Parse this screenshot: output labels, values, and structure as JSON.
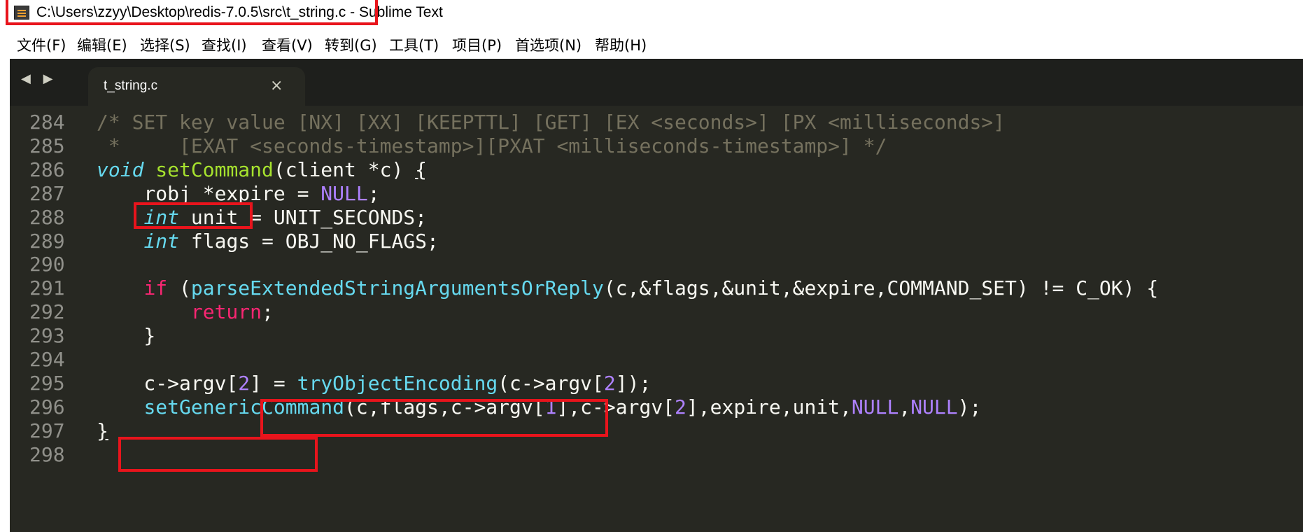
{
  "window": {
    "title": "C:\\Users\\zzyy\\Desktop\\redis-7.0.5\\src\\t_string.c - Sublime Text"
  },
  "menu": [
    "文件(F)",
    "编辑(E)",
    "选择(S)",
    "查找(I)",
    "查看(V)",
    "转到(G)",
    "工具(T)",
    "项目(P)",
    "首选项(N)",
    "帮助(H)"
  ],
  "tabs": {
    "active": {
      "label": "t_string.c",
      "close": "×"
    },
    "nav": "◀ ▶"
  },
  "code_lines": [
    {
      "num": "284",
      "tokens": [
        [
          "c-comment",
          "/* SET key value [NX] [XX] [KEEPTTL] [GET] [EX <seconds>] [PX <milliseconds>]"
        ]
      ]
    },
    {
      "num": "285",
      "tokens": [
        [
          "c-comment",
          " *     [EXAT <seconds-timestamp>][PXAT <milliseconds-timestamp>] */"
        ]
      ]
    },
    {
      "num": "286",
      "tokens": [
        [
          "c-type",
          "void"
        ],
        [
          "",
          " "
        ],
        [
          "c-func",
          "setCommand"
        ],
        [
          "",
          "(client *c) "
        ],
        [
          "c-brace",
          "{"
        ]
      ]
    },
    {
      "num": "287",
      "tokens": [
        [
          "",
          "    robj *expire = "
        ],
        [
          "c-const",
          "NULL"
        ],
        [
          "",
          ";"
        ]
      ]
    },
    {
      "num": "288",
      "tokens": [
        [
          "",
          "    "
        ],
        [
          "c-type",
          "int"
        ],
        [
          "",
          " unit = UNIT_SECONDS;"
        ]
      ]
    },
    {
      "num": "289",
      "tokens": [
        [
          "",
          "    "
        ],
        [
          "c-type",
          "int"
        ],
        [
          "",
          " flags = OBJ_NO_FLAGS;"
        ]
      ]
    },
    {
      "num": "290",
      "tokens": []
    },
    {
      "num": "291",
      "tokens": [
        [
          "",
          "    "
        ],
        [
          "c-kw",
          "if"
        ],
        [
          "",
          " ("
        ],
        [
          "c-call",
          "parseExtendedStringArgumentsOrReply"
        ],
        [
          "",
          "(c,&flags,&unit,&expire,COMMAND_SET) != C_OK) {"
        ]
      ]
    },
    {
      "num": "292",
      "tokens": [
        [
          "",
          "        "
        ],
        [
          "c-kw",
          "return"
        ],
        [
          "",
          ";"
        ]
      ]
    },
    {
      "num": "293",
      "tokens": [
        [
          "",
          "    }"
        ]
      ]
    },
    {
      "num": "294",
      "tokens": []
    },
    {
      "num": "295",
      "tokens": [
        [
          "",
          "    c->argv["
        ],
        [
          "c-num",
          "2"
        ],
        [
          "",
          "] = "
        ],
        [
          "c-call",
          "tryObjectEncoding"
        ],
        [
          "",
          "(c->argv["
        ],
        [
          "c-num",
          "2"
        ],
        [
          "",
          "]);"
        ]
      ]
    },
    {
      "num": "296",
      "tokens": [
        [
          "",
          "    "
        ],
        [
          "c-call",
          "setGenericCommand"
        ],
        [
          "",
          "(c,flags,c->argv["
        ],
        [
          "c-num",
          "1"
        ],
        [
          "",
          "],c->argv["
        ],
        [
          "c-num",
          "2"
        ],
        [
          "",
          "],expire,unit,"
        ],
        [
          "c-const",
          "NULL"
        ],
        [
          "",
          ","
        ],
        [
          "c-const",
          "NULL"
        ],
        [
          "",
          ");"
        ]
      ]
    },
    {
      "num": "297",
      "tokens": [
        [
          "c-brace",
          "}"
        ]
      ]
    },
    {
      "num": "298",
      "tokens": []
    }
  ],
  "colors": {
    "editor_bg": "#272822",
    "tabbar_bg": "#1e1f1c",
    "highlight_box": "#e8141c",
    "keyword": "#f92672",
    "function": "#a6e22e",
    "call": "#66d9ef",
    "number": "#ae81ff",
    "comment": "#75715e"
  }
}
